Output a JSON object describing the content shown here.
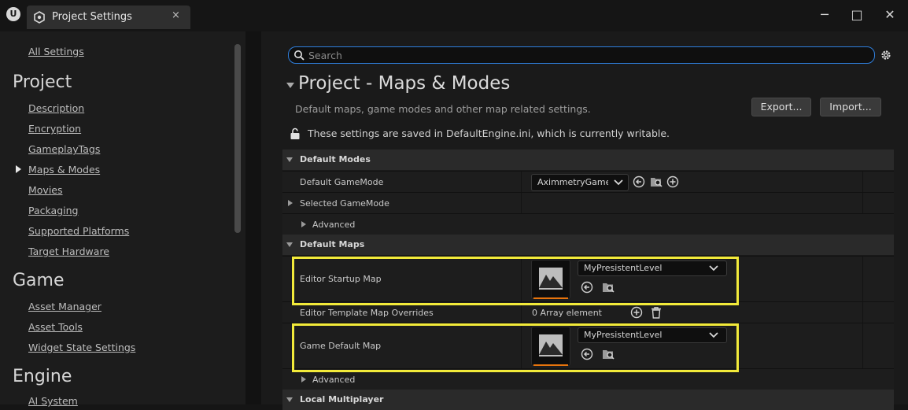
{
  "window": {
    "tab_title": "Project Settings",
    "tab_close": "×",
    "minimize": "─",
    "maximize": "□",
    "close": "✕"
  },
  "sidebar": {
    "all_settings": "All Settings",
    "sections": [
      {
        "title": "Project",
        "items": [
          "Description",
          "Encryption",
          "GameplayTags",
          "Maps & Modes",
          "Movies",
          "Packaging",
          "Supported Platforms",
          "Target Hardware"
        ]
      },
      {
        "title": "Game",
        "items": [
          "Asset Manager",
          "Asset Tools",
          "Widget State Settings"
        ]
      },
      {
        "title": "Engine",
        "items": [
          "AI System"
        ]
      }
    ],
    "selected": "Maps & Modes"
  },
  "search": {
    "placeholder": "Search",
    "value": ""
  },
  "category": {
    "title": "Project - Maps & Modes",
    "description": "Default maps, game modes and other map related settings.",
    "export_label": "Export...",
    "import_label": "Import...",
    "save_note": "These settings are saved in DefaultEngine.ini, which is currently writable."
  },
  "sections": {
    "default_modes": "Default Modes",
    "default_gamemode_label": "Default GameMode",
    "default_gamemode_value": "AximmetryGameMode",
    "selected_gamemode_label": "Selected GameMode",
    "advanced_1": "Advanced",
    "default_maps": "Default Maps",
    "editor_startup_map_label": "Editor Startup Map",
    "editor_startup_map_value": "MyPresistentLevel",
    "editor_template_label": "Editor Template Map Overrides",
    "editor_template_value": "0 Array element",
    "game_default_map_label": "Game Default Map",
    "game_default_map_value": "MyPresistentLevel",
    "advanced_2": "Advanced",
    "local_multiplayer": "Local Multiplayer"
  },
  "colors": {
    "highlight": "#f2ea3a",
    "accent": "#2f7fdd",
    "thumb_bar": "#e8740c"
  }
}
